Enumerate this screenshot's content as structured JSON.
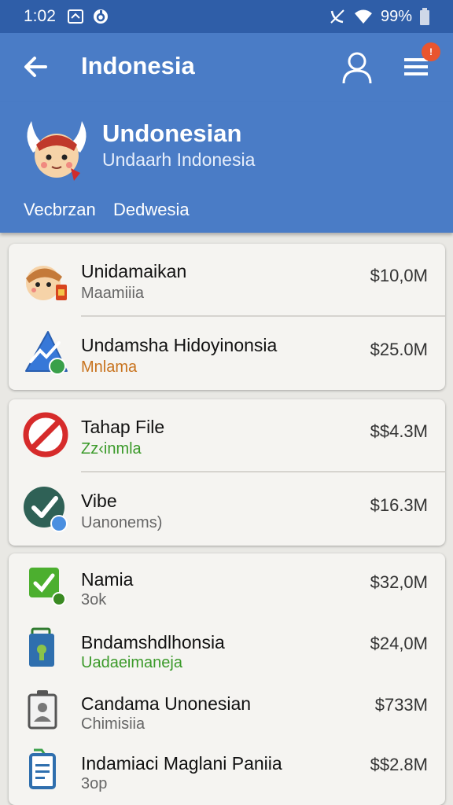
{
  "status_bar": {
    "time": "1:02",
    "battery": "99%"
  },
  "app_bar": {
    "title": "Indonesia",
    "notification_badge": "!"
  },
  "header": {
    "title": "Undonesian",
    "subtitle": "Undaarh Indonesia",
    "links": [
      "Vecbrzan",
      "Dedwesia"
    ]
  },
  "items": [
    {
      "name": "Unidamaikan",
      "sub": "Maamiiia",
      "amount": "$10,0M",
      "icon": "mascot-icon",
      "sub_color": "#666666"
    },
    {
      "name": "Undamsha Hidoyinonsia",
      "sub": "Mnlama",
      "amount": "$25.0M",
      "icon": "trend-chart-icon",
      "sub_color": "#c8731e"
    },
    {
      "name": "Tahap File",
      "sub": "Zz‹inmla",
      "amount": "$$4.3M",
      "icon": "prohibited-icon",
      "sub_color": "#3b9a2a"
    },
    {
      "name": "Vibe",
      "sub": "Uanonems)",
      "amount": "$16.3M",
      "icon": "checkmark-circle-icon",
      "sub_color": "#666666"
    },
    {
      "name": "Namia",
      "sub": "3ok",
      "amount": "$32,0M",
      "icon": "green-check-square-icon",
      "sub_color": "#666666"
    },
    {
      "name": "Bndamshdlhonsia",
      "sub": "Uadaeimaneja",
      "amount": "$24,0M",
      "icon": "lock-bag-icon",
      "sub_color": "#3b9a2a"
    },
    {
      "name": "Candama Unonesian",
      "sub": "Chimisiia",
      "amount": "$733M",
      "icon": "id-badge-icon",
      "sub_color": "#666666"
    },
    {
      "name": "Indamiaci Maglani Paniia",
      "sub": "3op",
      "amount": "$$2.8M",
      "icon": "document-icon",
      "sub_color": "#666666"
    }
  ],
  "colors": {
    "status_bar": "#2f5ea8",
    "app_bar": "#4a7cc6",
    "accent_orange": "#c8731e",
    "accent_green": "#3b9a2a"
  }
}
